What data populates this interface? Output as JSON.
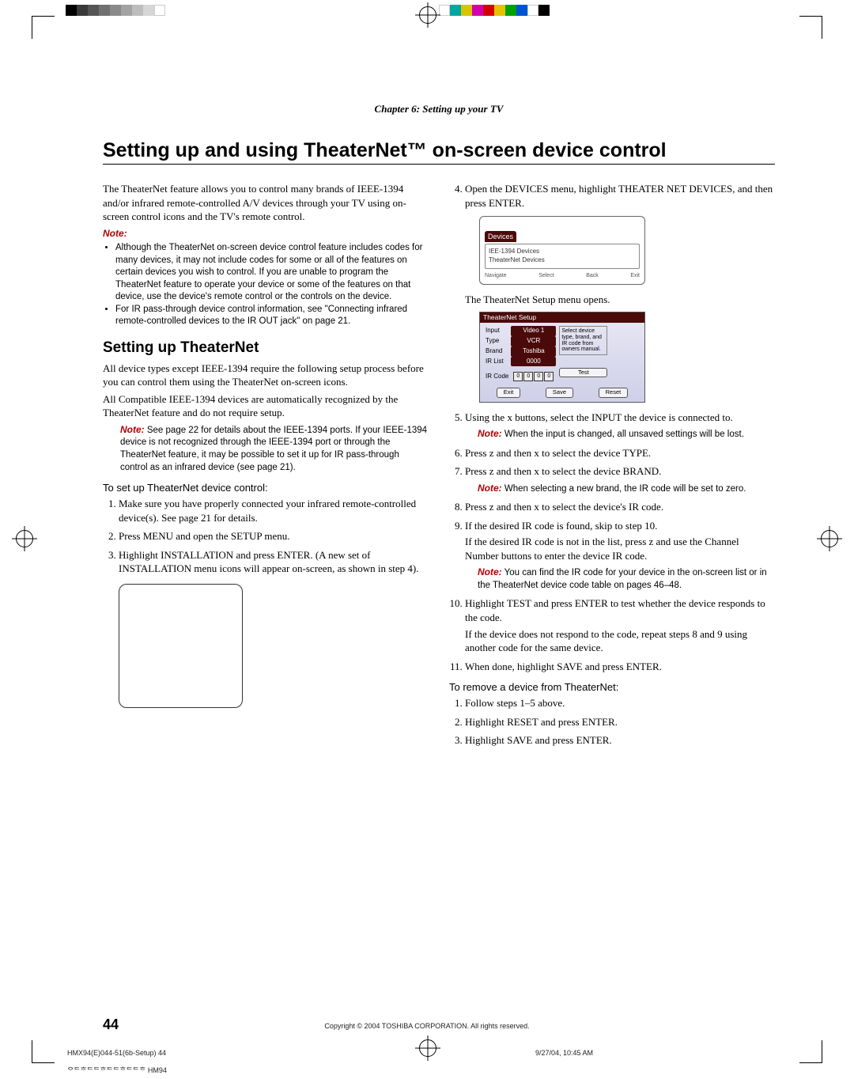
{
  "header": {
    "chapter": "Chapter 6: Setting up your TV"
  },
  "title": "Setting up and using TheaterNet™ on-screen device control",
  "left": {
    "intro": "The TheaterNet feature allows you to control many brands of IEEE-1394 and/or infrared remote-controlled A/V devices through your TV using on-screen control icons and the TV's remote control.",
    "note_label": "Note:",
    "note_b1": "Although the TheaterNet on-screen device control feature includes codes for many devices, it may not include codes for some or all of the features on certain devices you wish to control. If you are unable to program the TheaterNet feature to operate your device or some of the features on that device, use the device's remote control or the controls on the device.",
    "note_b2": "For IR pass-through device control information, see \"Connecting infrared remote-controlled devices to the IR OUT jack\" on page 21.",
    "section_title": "Setting up TheaterNet",
    "p1": "All device types except IEEE-1394 require the following setup process before you can control them using the TheaterNet on-screen icons.",
    "p2": "All Compatible IEEE-1394 devices are automatically recognized by the TheaterNet feature and do not require setup.",
    "note2": " See page 22 for details about the IEEE-1394 ports. If your IEEE-1394 device is not recognized through the IEEE-1394 port or through the TheaterNet feature, it may be possible to set it up for IR pass-through control as an infrared device (see page 21).",
    "subhead": "To set up TheaterNet device control:",
    "s1": "Make sure you have properly connected your infrared remote-controlled device(s). See page 21 for details.",
    "s2": "Press MENU and open the SETUP menu.",
    "s3": "Highlight INSTALLATION and press ENTER. (A new set of INSTALLATION menu icons will appear on-screen, as shown in step 4)."
  },
  "right": {
    "s4": "Open the DEVICES menu, highlight THEATER NET DEVICES, and then press ENTER.",
    "fig1": {
      "title": "Devices",
      "row1": "IEE-1394 Devices",
      "row2": "TheaterNet Devices",
      "nav": "Navigate",
      "sel": "Select",
      "back": "Back",
      "exit": "Exit"
    },
    "after_fig1": "The TheaterNet Setup menu opens.",
    "fig2": {
      "title": "TheaterNet Setup",
      "rows": {
        "input_l": "Input",
        "input_v": "Video 1",
        "type_l": "Type",
        "type_v": "VCR",
        "brand_l": "Brand",
        "brand_v": "Toshiba",
        "irlist_l": "IR List",
        "irlist_v": "0000",
        "ircode_l": "IR Code"
      },
      "hint": "Select device type, brand, and IR code from owners manual.",
      "btn_exit": "Exit",
      "btn_save": "Save",
      "btn_test": "Test",
      "btn_reset": "Reset"
    },
    "s5": "Using the x      buttons, select the INPUT the device is connected to.",
    "s5_note": " When the input is changed, all unsaved settings will be lost.",
    "s6": "Press z  and then x      to select the device TYPE.",
    "s7": "Press z  and then x      to select the device BRAND.",
    "s7_note": " When selecting a new brand, the IR code will be set to zero.",
    "s8": "Press z  and then x      to select the device's IR code.",
    "s9a": "If the desired IR code is found, skip to step 10.",
    "s9b": "If the desired IR code is not in the list, press z  and use the Channel Number buttons to enter the device IR code.",
    "s9_note": " You can find the IR code for your device in the on-screen list or in the TheaterNet device code table on pages 46–48.",
    "s10a": "Highlight TEST and press ENTER to test whether the device responds to the code.",
    "s10b": "If the device does not respond to the code, repeat steps 8 and 9 using another code for the same device.",
    "s11": "When done, highlight SAVE and press ENTER.",
    "remove_head": "To remove a device from TheaterNet:",
    "r1": "Follow steps 1–5 above.",
    "r2": "Highlight RESET and press ENTER.",
    "r3": "Highlight SAVE and press ENTER."
  },
  "footer": {
    "page": "44",
    "copyright": "Copyright © 2004 TOSHIBA CORPORATION. All rights reserved.",
    "left": "HMX94(E)044-51(6b-Setup)             44",
    "date": "9/27/04, 10:45 AM",
    "code": "ᄋᄃᄒᄃᄃᄒᄃᄃᄒᄃᄃᄒ HM94"
  },
  "colors": {
    "left": [
      "#000000",
      "#3a3a3a",
      "#555555",
      "#707070",
      "#8a8a8a",
      "#a3a3a3",
      "#bdbdbd",
      "#d6d6d6",
      "#ffffff",
      "#ffffff",
      "#ffffff"
    ],
    "right": [
      "#ffffff",
      "#00a7a0",
      "#d9c400",
      "#d400b0",
      "#d40000",
      "#e6c200",
      "#00a200",
      "#0054d4",
      "#ffffff",
      "#000000",
      "#ffffff"
    ]
  }
}
